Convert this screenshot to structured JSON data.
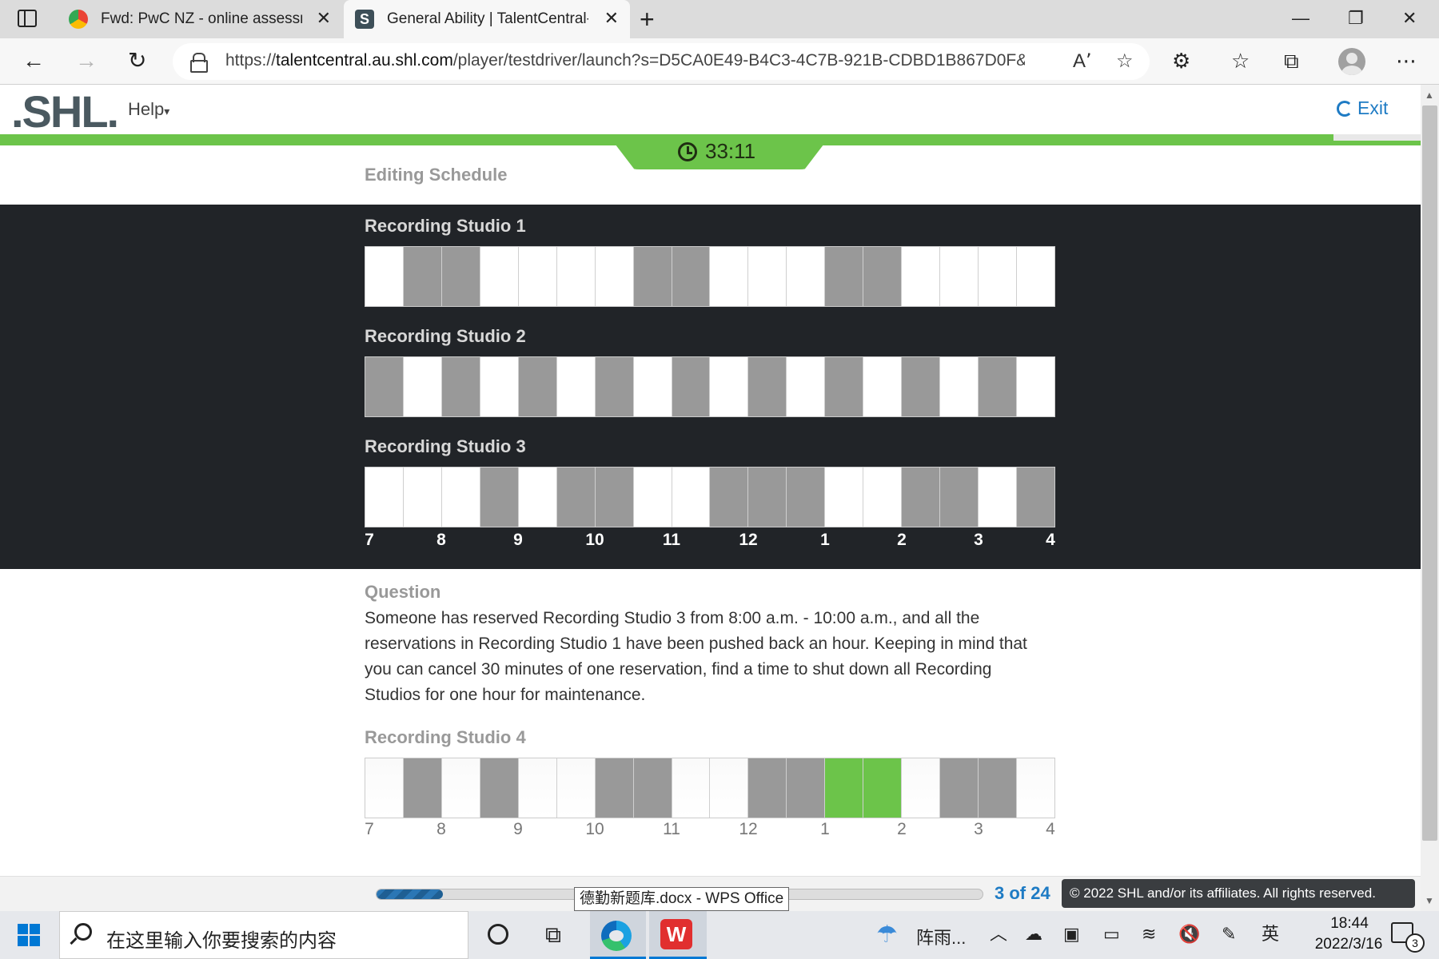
{
  "browser": {
    "tabs": [
      {
        "title": "Fwd: PwC NZ - online assessment",
        "favicon": "chrome-mail-icon",
        "active": false
      },
      {
        "title": "General Ability | TalentCentral-Candidate",
        "favicon": "shl-s-icon",
        "favicon_letter": "S",
        "active": true
      }
    ],
    "new_tab_glyph": "+",
    "url_prefix": "https://",
    "url_host": "talentcentral.au.shl.com",
    "url_path": "/player/testdriver/launch?s=D5CA0E49-B4C3-4C7B-921B-CDBD1B867D0F&fro..."
  },
  "app": {
    "logo_text": ".SHL.",
    "help_label": "Help",
    "exit_label": "Exit",
    "timer": "33:11",
    "scenario_title": "Editing Schedule"
  },
  "schedule": {
    "studios": [
      {
        "label": "Recording Studio 1",
        "slots": [
          0,
          1,
          1,
          0,
          0,
          0,
          0,
          1,
          1,
          0,
          0,
          0,
          1,
          1,
          0,
          0,
          0,
          0
        ]
      },
      {
        "label": "Recording Studio 2",
        "slots": [
          1,
          0,
          1,
          0,
          1,
          0,
          1,
          0,
          1,
          0,
          1,
          0,
          1,
          0,
          1,
          0,
          1,
          0
        ]
      },
      {
        "label": "Recording Studio 3",
        "slots": [
          0,
          0,
          0,
          1,
          0,
          1,
          1,
          0,
          0,
          1,
          1,
          1,
          0,
          0,
          1,
          1,
          0,
          1
        ]
      }
    ],
    "hours": [
      "7",
      "8",
      "9",
      "10",
      "11",
      "12",
      "1",
      "2",
      "3",
      "4"
    ]
  },
  "question": {
    "label": "Question",
    "text": "Someone has reserved Recording Studio 3 from 8:00 a.m. - 10:00 a.m., and all the reservations in Recording Studio 1 have been pushed back an hour. Keeping in mind that you can cancel 30 minutes of one reservation, find a time to shut down all Recording Studios for one hour for maintenance."
  },
  "answer": {
    "label": "Recording Studio 4",
    "slots": [
      0,
      1,
      0,
      1,
      0,
      0,
      1,
      1,
      0,
      0,
      1,
      1,
      2,
      2,
      0,
      1,
      1,
      0
    ],
    "legend": {
      "0": "free",
      "1": "busy",
      "2": "selected"
    }
  },
  "footer": {
    "progress_fraction": 0.11,
    "page_count": "3 of 24",
    "copyright": "© 2022 SHL and/or its affiliates. All rights reserved.",
    "taskbar_tooltip": "德勤新题库.docx - WPS Office"
  },
  "taskbar": {
    "search_placeholder": "在这里输入你要搜索的内容",
    "weather_text": "阵雨...",
    "ime_label": "英",
    "time": "18:44",
    "date": "2022/3/16",
    "notification_count": "3",
    "wps_glyph": "W"
  },
  "colors": {
    "brand_green": "#6cc44a",
    "busy_gray": "#999999",
    "dark_panel": "#212428",
    "link_blue": "#1e7bc4"
  }
}
